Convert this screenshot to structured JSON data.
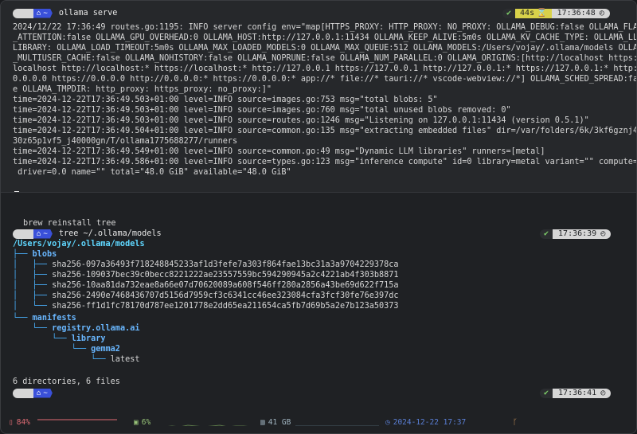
{
  "top_pane": {
    "prompt": {
      "apple_icon": "apple-icon",
      "home_icon": "home-icon",
      "path": "~",
      "command": "ollama serve"
    },
    "status": {
      "check": "✔",
      "duration": "44s",
      "hourglass": "⌛",
      "time": "17:36:48",
      "clock_icon": "◴"
    },
    "log_lines": [
      "2024/12/22 17:36:49 routes.go:1195: INFO server config env=\"map[HTTPS_PROXY: HTTP_PROXY: NO_PROXY: OLLAMA_DEBUG:false OLLAMA_FLASH",
      "_ATTENTION:false OLLAMA_GPU_OVERHEAD:0 OLLAMA_HOST:http://127.0.0.1:11434 OLLAMA_KEEP_ALIVE:5m0s OLLAMA_KV_CACHE_TYPE: OLLAMA_LLM_",
      "LIBRARY: OLLAMA_LOAD_TIMEOUT:5m0s OLLAMA_MAX_LOADED_MODELS:0 OLLAMA_MAX_QUEUE:512 OLLAMA_MODELS:/Users/vojay/.ollama/models OLLAMA",
      "_MULTIUSER_CACHE:false OLLAMA_NOHISTORY:false OLLAMA_NOPRUNE:false OLLAMA_NUM_PARALLEL:0 OLLAMA_ORIGINS:[http://localhost https://",
      "localhost http://localhost:* https://localhost:* http://127.0.0.1 https://127.0.0.1 http://127.0.0.1:* https://127.0.0.1:* http://",
      "0.0.0.0 https://0.0.0.0 http://0.0.0.0:* https://0.0.0.0:* app://* file://* tauri://* vscode-webview://*] OLLAMA_SCHED_SPREAD:fals",
      "e OLLAMA_TMPDIR: http_proxy: https_proxy: no_proxy:]\"",
      "time=2024-12-22T17:36:49.503+01:00 level=INFO source=images.go:753 msg=\"total blobs: 5\"",
      "time=2024-12-22T17:36:49.503+01:00 level=INFO source=images.go:760 msg=\"total unused blobs removed: 0\"",
      "time=2024-12-22T17:36:49.503+01:00 level=INFO source=routes.go:1246 msg=\"Listening on 127.0.0.1:11434 (version 0.5.1)\"",
      "time=2024-12-22T17:36:49.504+01:00 level=INFO source=common.go:135 msg=\"extracting embedded files\" dir=/var/folders/6k/3kf6gznj41s",
      "30z65p1vf5_j40000gn/T/ollama1775688277/runners",
      "time=2024-12-22T17:36:49.549+01:00 level=INFO source=common.go:49 msg=\"Dynamic LLM libraries\" runners=[metal]",
      "time=2024-12-22T17:36:49.586+01:00 level=INFO source=types.go:123 msg=\"inference compute\" id=0 library=metal variant=\"\" compute=\"\"",
      " driver=0.0 name=\"\" total=\"48.0 GiB\" available=\"48.0 GiB\""
    ]
  },
  "bottom_pane": {
    "prev_command": "brew reinstall tree",
    "prompt1": {
      "path": "~",
      "command": "tree ~/.ollama/models",
      "check": "✔",
      "time": "17:36:39"
    },
    "tree": {
      "root": "/Users/vojay/.ollama/models",
      "blobs_dir": "blobs",
      "blobs": [
        "sha256-097a36493f718248845233af1d3fefe7a303f864fae13bc31a3a9704229378ca",
        "sha256-109037bec39c0becc8221222ae23557559bc594290945a2c4221ab4f303b8871",
        "sha256-10aa81da732eae8a66e07d70620089a608f546ff280a2856a43be69d622f715a",
        "sha256-2490e7468436707d5156d7959cf3c6341cc46ee323084cfa3fcf30fe76e397dc",
        "sha256-ff1d1fc78170d787ee1201778e2dd65ea211654ca5fb7d69b5a2e7b123a50373"
      ],
      "manifests_dir": "manifests",
      "registry_dir": "registry.ollama.ai",
      "library_dir": "library",
      "gemma_dir": "gemma2",
      "latest_file": "latest",
      "summary": "6 directories, 6 files"
    },
    "prompt2": {
      "path": "~",
      "check": "✔",
      "time": "17:36:41"
    }
  },
  "statusbar": {
    "battery_icon": "battery-icon",
    "battery": "84%",
    "cpu_icon": "cpu-icon",
    "cpu": "6%",
    "mem_icon": "memory-icon",
    "mem": "41 GB",
    "date_icon": "calendar-clock-icon",
    "datetime": "2024-12-22 17:37",
    "branch_icon": "git-branch-icon",
    "colors": {
      "battery": "#e06c75",
      "cpu": "#98c379",
      "date": "#5a7fd6"
    }
  }
}
